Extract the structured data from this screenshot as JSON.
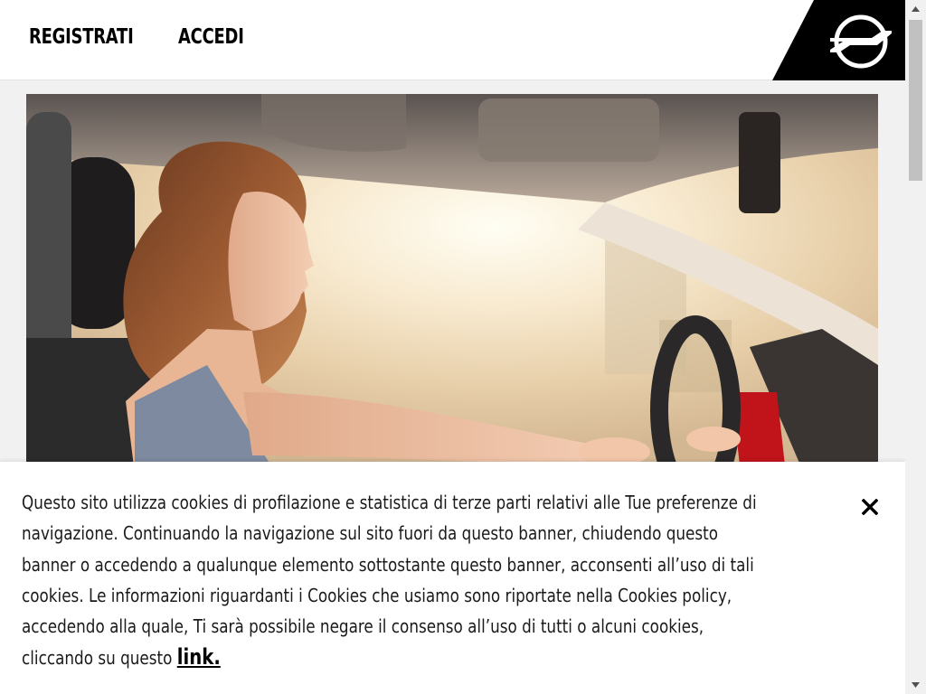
{
  "header": {
    "nav": {
      "register_label": "REGISTRATI",
      "login_label": "ACCEDI"
    },
    "logo_icon": "opel-lightning-logo-icon"
  },
  "hero": {
    "image": "woman-driving-car-photo"
  },
  "cookie_banner": {
    "text_lines": [
      "Questo sito utilizza cookies di profilazione e statistica di terze parti relativi alle Tue preferenze di",
      "navigazione. Continuando la navigazione sul sito fuori da questo banner, chiudendo questo",
      "banner o accedendo a qualunque elemento sottostante questo banner, acconsenti all’uso di tali",
      "cookies. Le informazioni riguardanti i Cookies che usiamo sono riportate nella Cookies policy,",
      "accedendo alla quale, Ti sarà possibile negare il consenso all’uso di tutti o alcuni cookies,",
      "cliccando su questo "
    ],
    "link_label": "link.",
    "close_icon": "close-icon"
  },
  "scrollbar": {
    "up_icon": "scroll-up-arrow-icon",
    "down_icon": "scroll-down-arrow-icon"
  },
  "colors": {
    "brand_black": "#000000",
    "background": "#f1f1f1",
    "banner_bg": "#ffffff"
  }
}
